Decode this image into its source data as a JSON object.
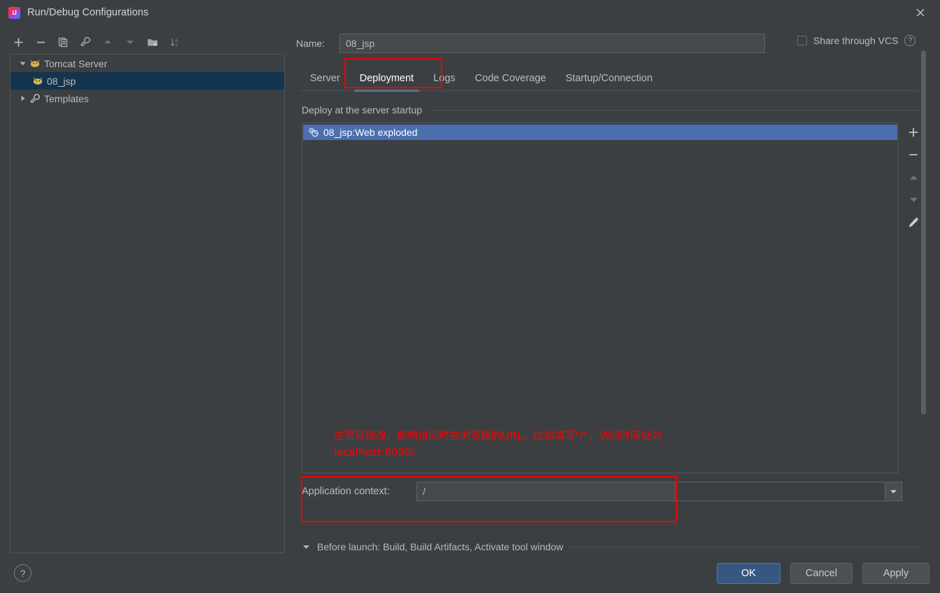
{
  "window": {
    "title": "Run/Debug Configurations",
    "app_icon": "intellij-idea-icon",
    "close_icon": "close-icon"
  },
  "left_toolbar": {
    "buttons": [
      {
        "name": "add-configuration-button",
        "icon": "plus-icon",
        "enabled": true
      },
      {
        "name": "remove-configuration-button",
        "icon": "minus-icon",
        "enabled": true
      },
      {
        "name": "copy-configuration-button",
        "icon": "copy-icon",
        "enabled": true
      },
      {
        "name": "edit-templates-button",
        "icon": "wrench-icon",
        "enabled": true
      },
      {
        "name": "move-up-button",
        "icon": "arrow-up-icon",
        "enabled": false
      },
      {
        "name": "move-down-button",
        "icon": "arrow-down-icon",
        "enabled": false
      },
      {
        "name": "new-folder-button",
        "icon": "folder-add-icon",
        "enabled": true
      },
      {
        "name": "sort-configurations-button",
        "icon": "sort-az-icon",
        "enabled": true
      }
    ]
  },
  "tree": {
    "nodes": [
      {
        "label": "Tomcat Server",
        "icon": "tomcat-icon",
        "expanded": true,
        "selected": false,
        "depth": 0
      },
      {
        "label": "08_jsp",
        "icon": "tomcat-icon",
        "expanded": null,
        "selected": true,
        "depth": 1
      },
      {
        "label": "Templates",
        "icon": "wrench-icon",
        "expanded": false,
        "selected": false,
        "depth": 0
      }
    ]
  },
  "name_field": {
    "label": "Name:",
    "value": "08_jsp",
    "placeholder": ""
  },
  "share": {
    "label": "Share through VCS",
    "checked": false,
    "help_icon": "question-circle-icon"
  },
  "tabs": [
    {
      "label": "Server",
      "active": false
    },
    {
      "label": "Deployment",
      "active": true
    },
    {
      "label": "Logs",
      "active": false
    },
    {
      "label": "Code Coverage",
      "active": false
    },
    {
      "label": "Startup/Connection",
      "active": false
    }
  ],
  "deployment": {
    "section_title": "Deploy at the server startup",
    "items": [
      {
        "label": "08_jsp:Web exploded",
        "icon": "artifact-icon",
        "selected": true
      }
    ],
    "side_buttons": [
      {
        "name": "add-artifact-button",
        "icon": "plus-icon",
        "enabled": true
      },
      {
        "name": "remove-artifact-button",
        "icon": "minus-icon",
        "enabled": true
      },
      {
        "name": "move-artifact-up-button",
        "icon": "arrow-up-icon",
        "enabled": false
      },
      {
        "name": "move-artifact-down-button",
        "icon": "arrow-down-icon",
        "enabled": false
      },
      {
        "name": "edit-artifact-button",
        "icon": "pencil-icon",
        "enabled": true
      }
    ]
  },
  "annotation": {
    "line1": "这里可修改，影响访问时在浏览器的URL，比如填写\"/\"，访问时网址为",
    "line2": "localhost:8080/",
    "color": "#ff0000"
  },
  "application_context": {
    "label": "Application context:",
    "value": "/",
    "dropdown_icon": "chevron-down-icon"
  },
  "before_launch": {
    "caret_icon": "chevron-down-icon",
    "text": "Before launch: Build, Build Artifacts, Activate tool window"
  },
  "footer": {
    "help_icon": "question-circle-icon",
    "buttons": [
      {
        "label": "OK",
        "primary": true
      },
      {
        "label": "Cancel",
        "primary": false
      },
      {
        "label": "Apply",
        "primary": false
      }
    ]
  },
  "colors": {
    "background": "#3c3f41",
    "selection_blue": "#4b6eaf",
    "tree_selection": "#13344f",
    "tab_accent": "#4a88c7",
    "primary_button": "#365880",
    "annotation_red": "#ff0000",
    "highlight_red": "#f40000",
    "text": "#bbbbbb"
  }
}
